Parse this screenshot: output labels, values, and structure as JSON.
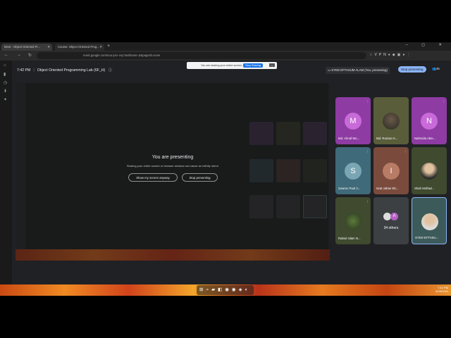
{
  "browser": {
    "tabs": [
      {
        "label": "Meet - Object Oriented Pr..."
      },
      {
        "label": "Course: Object Oriented Prog..."
      }
    ],
    "new_tab": "+",
    "window_controls": "– ◻ ✕",
    "url": "meet.google.com/xou-jocr-xvy?authuser=3&pageId=none",
    "vpn": "VPN"
  },
  "meet": {
    "time": "7:42 PM",
    "title": "Object Oriented Programming Lab (6F_H)",
    "share_banner": {
      "text": "You are sharing your entire screen.",
      "stop_label": "Stop Sharing",
      "minimize_label": "–"
    },
    "presenter_label": "SYED EFTASUM ALAM (You, presenting)",
    "stop_presenting_top": "Stop presenting",
    "participant_count": "45",
    "presenting": {
      "title": "You are presenting",
      "subtitle": "Sharing your entire screen or browser window can cause an infinity mirror",
      "show_anyway": "Show my screen anyway",
      "stop": "Stop presenting"
    },
    "participants": [
      {
        "name": "Md. Ahnaf Mu...",
        "initial": "M",
        "color": "#8e3ba3"
      },
      {
        "name": "Md. Roman H...",
        "initial": "",
        "color": "#5a5d3a"
      },
      {
        "name": "Nahmida Akte...",
        "initial": "N",
        "color": "#8e3ba3"
      },
      {
        "name": "Sowrov Paul 2...",
        "initial": "S",
        "color": "#3f6a79"
      },
      {
        "name": "Israt Jahan Eb...",
        "initial": "I",
        "color": "#7a4b3c"
      },
      {
        "name": "Shah Moftasi...",
        "initial": "",
        "color": "#3f4a2f"
      },
      {
        "name": "Rabiul Islam N...",
        "initial": "",
        "color": "#3f4a2f"
      },
      {
        "name": "34 others",
        "initial": "A",
        "color": "#3c4043"
      },
      {
        "name": "SYED EFTASU...",
        "initial": "",
        "color": "#3d5a5a"
      }
    ]
  },
  "taskbar": {
    "time": "7:42 PM",
    "date": "6/26/2024"
  }
}
